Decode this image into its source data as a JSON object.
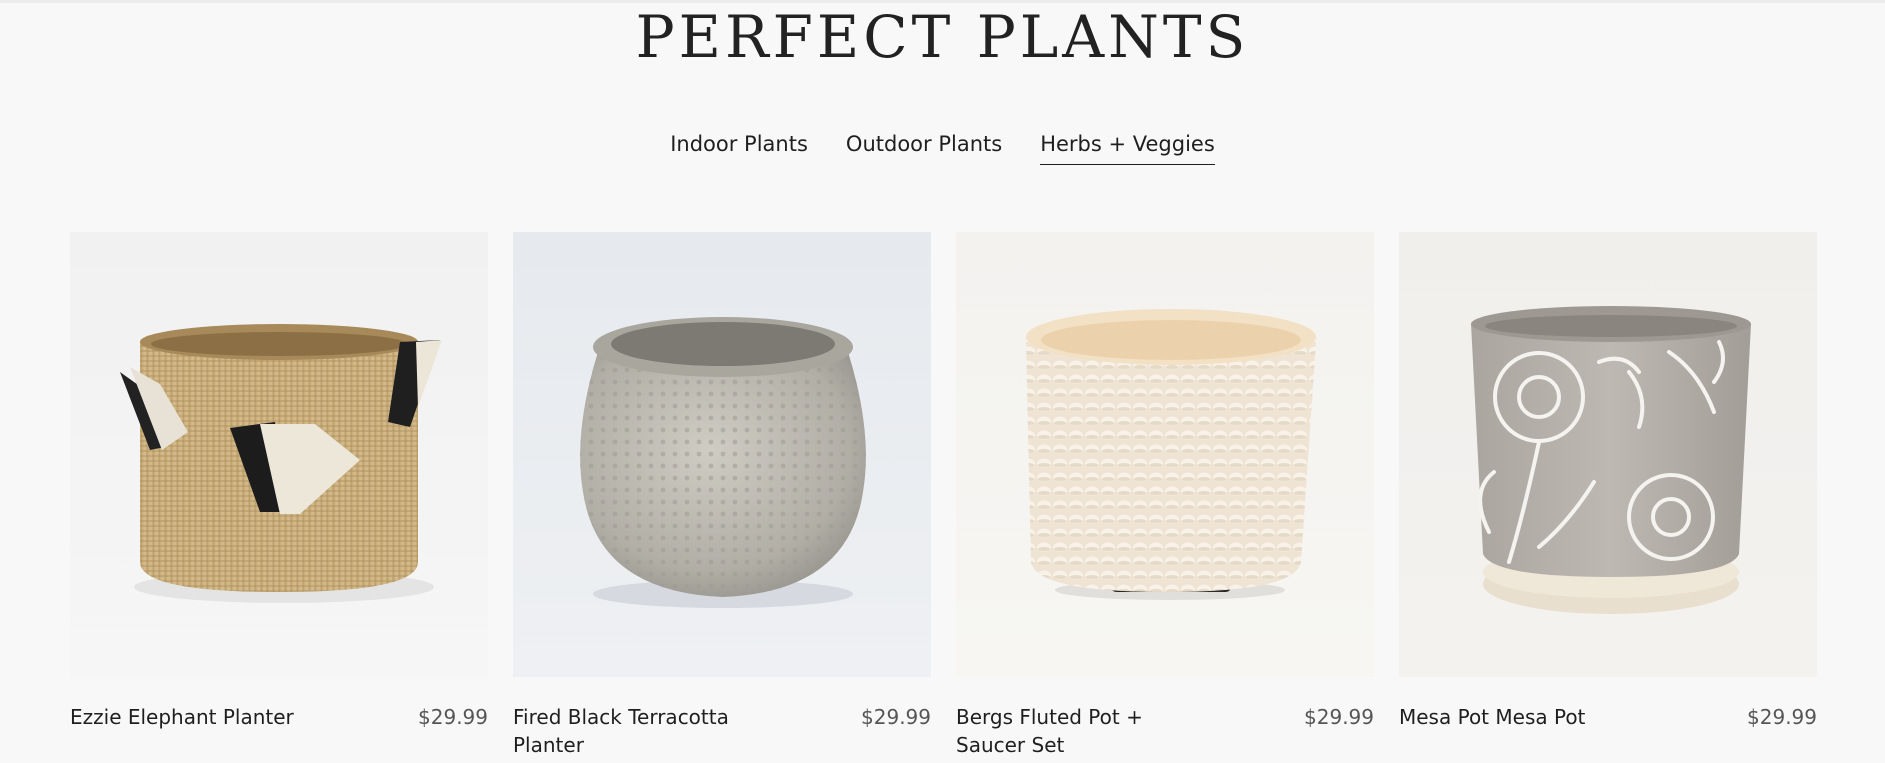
{
  "page": {
    "title": "PERFECT PLANTS"
  },
  "tabs": [
    {
      "label": "Indoor Plants",
      "active": false
    },
    {
      "label": "Outdoor Plants",
      "active": false
    },
    {
      "label": "Herbs + Veggies",
      "active": true
    }
  ],
  "products": [
    {
      "name": "Ezzie Elephant Planter",
      "price": "$29.99",
      "image_icon": "woven-basket-planter-image"
    },
    {
      "name": "Fired Black Terracotta Planter",
      "price": "$29.99",
      "image_icon": "textured-stone-pot-image"
    },
    {
      "name": "Bergs Fluted Pot + Saucer Set",
      "price": "$29.99",
      "image_icon": "knit-cream-pot-image"
    },
    {
      "name": "Mesa Pot Mesa Pot",
      "price": "$29.99",
      "image_icon": "floral-embossed-pot-image"
    }
  ],
  "colors": {
    "background": "#f8f8f8",
    "text": "#1f1f1f",
    "price": "#555555"
  }
}
